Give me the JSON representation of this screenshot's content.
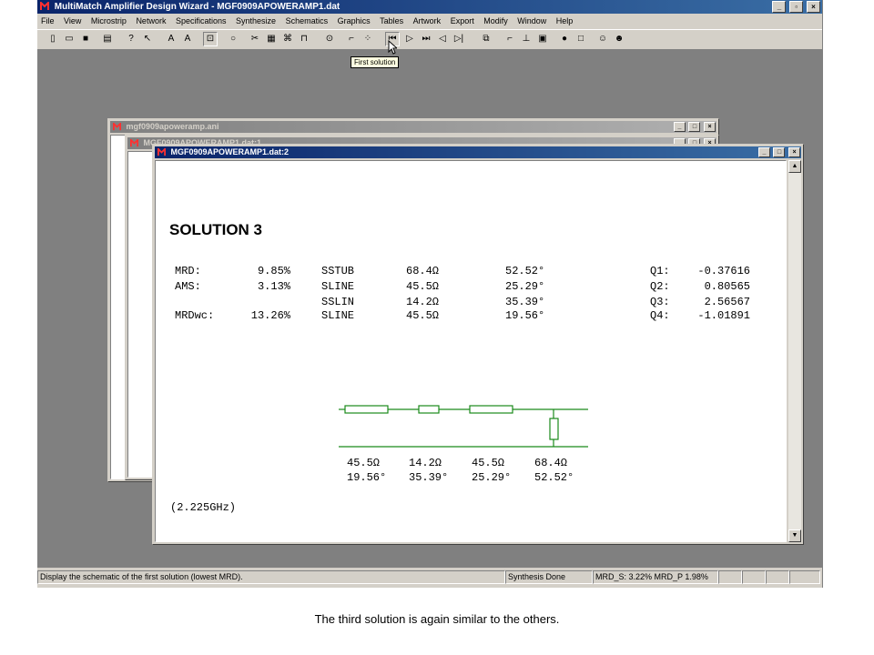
{
  "app": {
    "title": "MultiMatch Amplifier Design Wizard - MGF0909APOWERAMP1.dat",
    "window_buttons": [
      "_",
      "▫",
      "×"
    ]
  },
  "menu": [
    "File",
    "View",
    "Microstrip",
    "Network",
    "Specifications",
    "Synthesize",
    "Schematics",
    "Graphics",
    "Tables",
    "Artwork",
    "Export",
    "Modify",
    "Window",
    "Help"
  ],
  "tooltip": "First solution",
  "windows": {
    "back": {
      "title": "mgf0909apoweramp.ani"
    },
    "middle": {
      "title": "MGF0909APOWERAMP1.dat:1"
    },
    "front": {
      "title": "MGF0909APOWERAMP1.dat:2"
    }
  },
  "solution": {
    "heading": "SOLUTION 3",
    "rows": [
      {
        "metric": "MRD:",
        "metric_val": "9.85%",
        "elem": "SSTUB",
        "imp": "68.4Ω",
        "angle": "52.52°",
        "q": "Q1:",
        "q_val": "-0.37616"
      },
      {
        "metric": "AMS:",
        "metric_val": "3.13%",
        "elem": "SLINE",
        "imp": "45.5Ω",
        "angle": "25.29°",
        "q": "Q2:",
        "q_val": "0.80565"
      },
      {
        "metric": "",
        "metric_val": "",
        "elem": "SSLIN",
        "imp": "14.2Ω",
        "angle": "35.39°",
        "q": "Q3:",
        "q_val": "2.56567"
      },
      {
        "metric": "MRDwc:",
        "metric_val": "13.26%",
        "elem": "SLINE",
        "imp": "45.5Ω",
        "angle": "19.56°",
        "q": "Q4:",
        "q_val": "-1.01891"
      }
    ],
    "schematic_labels": [
      {
        "imp": "45.5Ω",
        "angle": "19.56°"
      },
      {
        "imp": "14.2Ω",
        "angle": "35.39°"
      },
      {
        "imp": "45.5Ω",
        "angle": "25.29°"
      },
      {
        "imp": "68.4Ω",
        "angle": "52.52°"
      }
    ],
    "frequency": "(2.225GHz)"
  },
  "status": {
    "message": "Display the schematic of the first solution (lowest MRD).",
    "state": "Synthesis Done",
    "mrd": "MRD_S:  3.22% MRD_P  1.98%"
  },
  "caption": "The third solution is again similar to the others.",
  "colors": {
    "schematic": "#1a8a1a",
    "titlebar": "#0a246a"
  }
}
